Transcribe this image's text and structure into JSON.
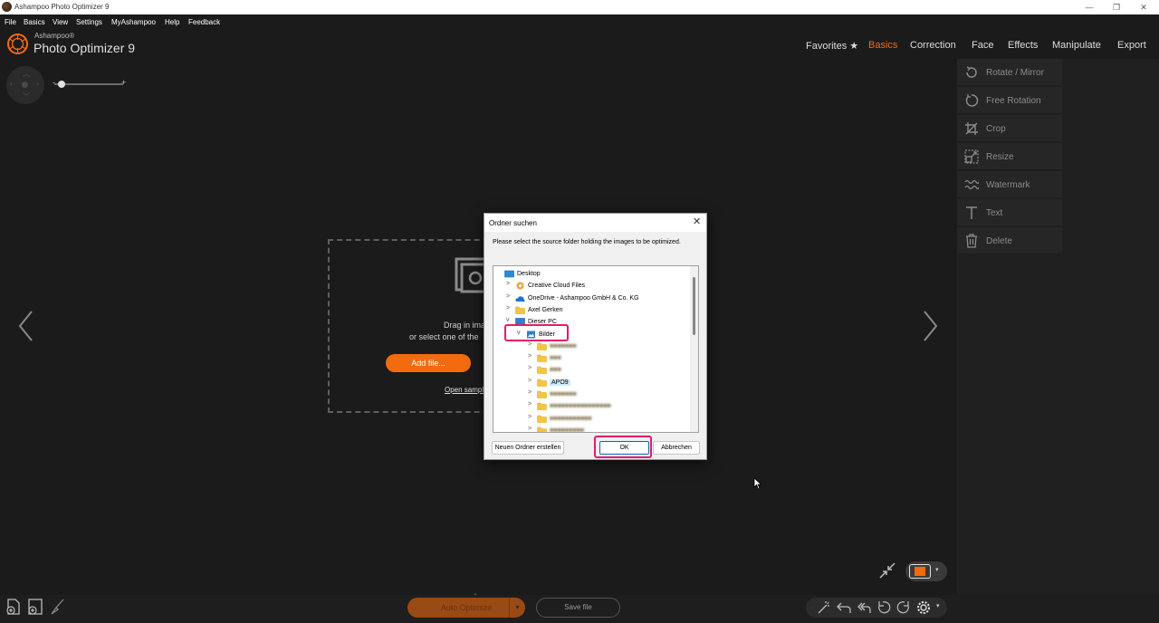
{
  "window": {
    "title": "Ashampoo Photo Optimizer 9",
    "min": "—",
    "max": "❐",
    "close": "✕"
  },
  "menu": [
    "File",
    "Basics",
    "View",
    "Settings",
    "MyAshampoo",
    "Help",
    "Feedback"
  ],
  "brand": {
    "small": "Ashampoo®",
    "big": "Photo Optimizer 9"
  },
  "tabs": [
    "Favorites ★",
    "Basics",
    "Correction",
    "Face",
    "Effects",
    "Manipulate",
    "Export"
  ],
  "active_tab": "Basics",
  "zoom": {
    "minus": "-",
    "plus": "+",
    "level": 0.08
  },
  "dropzone": {
    "line1": "Drag in ima",
    "line2": "or select one of the",
    "add_button": "Add file...",
    "open_sample": "Open sampl"
  },
  "tools": [
    "Rotate / Mirror",
    "Free Rotation",
    "Crop",
    "Resize",
    "Watermark",
    "Text",
    "Delete"
  ],
  "bottom": {
    "auto_optimize": "Auto Optimize",
    "save_file": "Save file",
    "dropdown": "▾",
    "collapse": "⌄"
  },
  "dialog": {
    "title": "Ordner suchen",
    "close": "✕",
    "instruction": "Please select the source folder holding the images to be optimized.",
    "tree": [
      {
        "label": "Desktop",
        "indent": 0,
        "expander": "",
        "icon": "desktop"
      },
      {
        "label": "Creative Cloud Files",
        "indent": 1,
        "expander": ">",
        "icon": "cc"
      },
      {
        "label": "OneDrive - Ashampoo GmbH & Co. KG",
        "indent": 1,
        "expander": ">",
        "icon": "cloud"
      },
      {
        "label": "Axel Gerken",
        "indent": 1,
        "expander": ">",
        "icon": "folder"
      },
      {
        "label": "Dieser PC",
        "indent": 1,
        "expander": "v",
        "icon": "pc"
      },
      {
        "label": "Bilder",
        "indent": 2,
        "expander": "v",
        "icon": "pictures"
      },
      {
        "label": "■■■■■■■",
        "indent": 3,
        "expander": ">",
        "icon": "folder",
        "blurred": true
      },
      {
        "label": "■■■",
        "indent": 3,
        "expander": ">",
        "icon": "folder",
        "blurred": true
      },
      {
        "label": "■■■",
        "indent": 3,
        "expander": ">",
        "icon": "folder",
        "blurred": true
      },
      {
        "label": "APO9",
        "indent": 3,
        "expander": ">",
        "icon": "folder",
        "selected": true
      },
      {
        "label": "■■■■■■■",
        "indent": 3,
        "expander": ">",
        "icon": "folder",
        "blurred": true
      },
      {
        "label": "■■■■■■■■■■■■■■■■",
        "indent": 3,
        "expander": ">",
        "icon": "folder",
        "blurred": true
      },
      {
        "label": "■■■■■■■■■■■",
        "indent": 3,
        "expander": ">",
        "icon": "folder",
        "blurred": true
      },
      {
        "label": "■■■■■■■■■",
        "indent": 3,
        "expander": ">",
        "icon": "folder",
        "blurred": true
      }
    ],
    "buttons": {
      "new_folder": "Neuen Ordner erstellen",
      "ok": "OK",
      "cancel": "Abbrechen"
    }
  },
  "colors": {
    "accent": "#f26b0f",
    "highlight": "#e8196b",
    "dialog_bg": "#f0f0f0",
    "app_bg": "#1b1b1b"
  }
}
